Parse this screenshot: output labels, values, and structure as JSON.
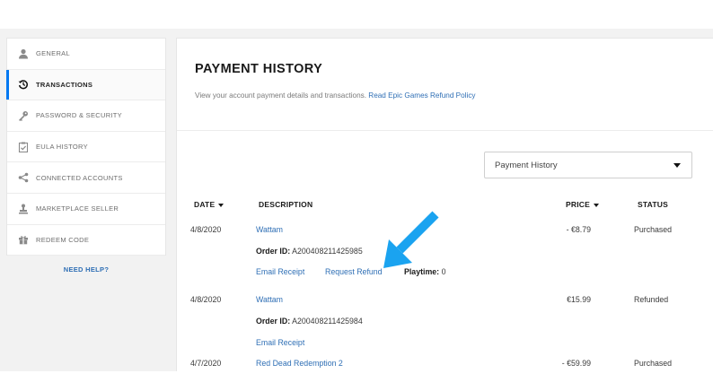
{
  "sidebar": {
    "items": [
      {
        "label": "GENERAL",
        "icon": "user-icon"
      },
      {
        "label": "TRANSACTIONS",
        "icon": "history-icon"
      },
      {
        "label": "PASSWORD & SECURITY",
        "icon": "key-icon"
      },
      {
        "label": "EULA HISTORY",
        "icon": "clipboard-check-icon"
      },
      {
        "label": "CONNECTED ACCOUNTS",
        "icon": "share-icon"
      },
      {
        "label": "MARKETPLACE SELLER",
        "icon": "stamp-icon"
      },
      {
        "label": "REDEEM CODE",
        "icon": "gift-icon"
      }
    ],
    "active_index": 1,
    "help_label": "NEED HELP?"
  },
  "main": {
    "title": "PAYMENT HISTORY",
    "subtitle": "View your account payment details and transactions.",
    "policy_link": "Read Epic Games Refund Policy",
    "filter": {
      "selected": "Payment History"
    },
    "columns": {
      "date": "DATE",
      "description": "DESCRIPTION",
      "price": "PRICE",
      "status": "STATUS"
    },
    "transactions": [
      {
        "date": "4/8/2020",
        "title": "Wattam",
        "order_label": "Order ID:",
        "order_id": "A200408211425985",
        "email_receipt": "Email Receipt",
        "request_refund": "Request Refund",
        "playtime_label": "Playtime:",
        "playtime": "0",
        "price": "- €8.79",
        "status": "Purchased"
      },
      {
        "date": "4/8/2020",
        "title": "Wattam",
        "order_label": "Order ID:",
        "order_id": "A200408211425984",
        "email_receipt": "Email Receipt",
        "price": "€15.99",
        "status": "Refunded"
      },
      {
        "date": "4/7/2020",
        "title": "Red Dead Redemption 2",
        "price": "- €59.99",
        "status": "Purchased"
      }
    ]
  },
  "colors": {
    "accent": "#0078f2",
    "link": "#2f6fb5",
    "arrow": "#1aa3f0"
  }
}
